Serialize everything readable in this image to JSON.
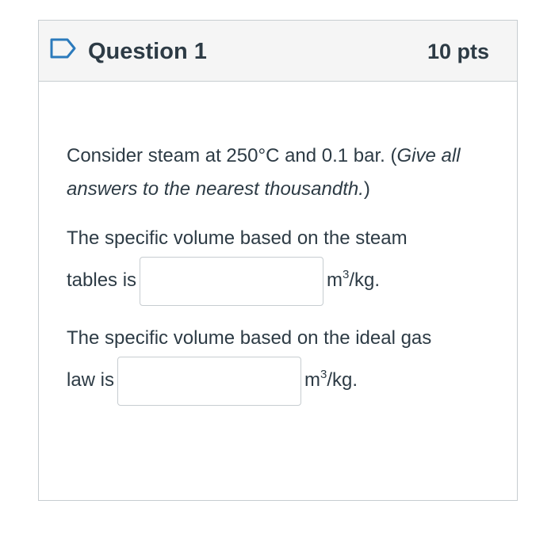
{
  "question": {
    "title": "Question 1",
    "points": "10 pts"
  },
  "body": {
    "intro_plain": "Consider steam at 250°C and 0.1 bar. (",
    "intro_italic": "Give all answers to the nearest thousandth.",
    "intro_close": ")",
    "q1_text_line1": "The specific volume based on the steam",
    "q1_text_before": "tables is",
    "q1_unit_base": "m",
    "q1_unit_exp": "3",
    "q1_unit_rest": "/kg.",
    "q1_value": "",
    "q2_text_line1": "The specific volume based on the ideal gas",
    "q2_text_before": "law is",
    "q2_unit_base": "m",
    "q2_unit_exp": "3",
    "q2_unit_rest": "/kg.",
    "q2_value": ""
  },
  "icons": {
    "flag": "flag-outline-icon"
  },
  "colors": {
    "text": "#2d3b45",
    "header_bg": "#f5f5f5",
    "border": "#c7cdd1",
    "flag": "#2b7abc"
  }
}
